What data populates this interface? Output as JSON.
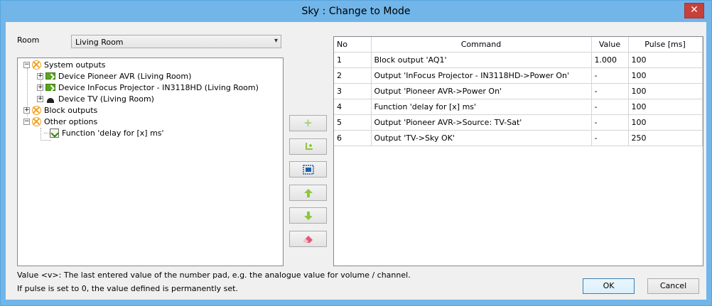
{
  "window": {
    "title": "Sky : Change to Mode",
    "close_label": "✕"
  },
  "room": {
    "label": "Room",
    "selected": "Living Room"
  },
  "tree": {
    "system_outputs": "System outputs",
    "device_pioneer": "Device Pioneer AVR (Living Room)",
    "device_infocus": "Device InFocus Projector - IN3118HD (Living Room)",
    "device_tv": "Device TV (Living Room)",
    "block_outputs": "Block outputs",
    "other_options": "Other options",
    "function_delay": "Function 'delay for [x] ms'"
  },
  "toolbar": {
    "add_icon": "plus-icon",
    "add_sub_icon": "add-subitem-icon",
    "select_icon": "select-box-icon",
    "up_icon": "arrow-up-icon",
    "down_icon": "arrow-down-icon",
    "erase_icon": "eraser-icon",
    "accent_green": "#8dc63f",
    "accent_blue": "#1f5fa8"
  },
  "table": {
    "headers": [
      "No",
      "Command",
      "Value",
      "Pulse [ms]"
    ],
    "rows": [
      [
        "1",
        "Block output 'AQ1'",
        "1.000",
        "100"
      ],
      [
        "2",
        "Output 'InFocus Projector - IN3118HD->Power On'",
        "-",
        "100"
      ],
      [
        "3",
        "Output 'Pioneer AVR->Power On'",
        "-",
        "100"
      ],
      [
        "4",
        "Function 'delay for [x] ms'",
        "-",
        "100"
      ],
      [
        "5",
        "Output 'Pioneer AVR->Source: TV-Sat'",
        "-",
        "100"
      ],
      [
        "6",
        "Output 'TV->Sky OK'",
        "-",
        "250"
      ]
    ]
  },
  "info": {
    "line1": "Value <v>: The last entered value of the number pad, e.g. the analogue value for volume / channel.",
    "line2": "If pulse is set to 0, the value defined is permanently set."
  },
  "buttons": {
    "ok": "OK",
    "cancel": "Cancel"
  }
}
